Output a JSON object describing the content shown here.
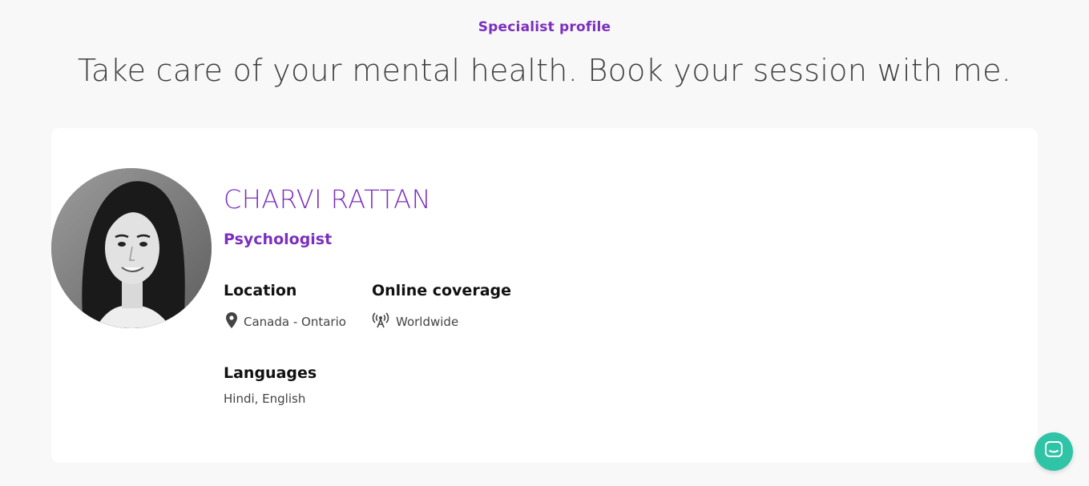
{
  "header": {
    "eyebrow": "Specialist profile",
    "headline": "Take care of your mental health. Book your session with me."
  },
  "profile": {
    "name": "CHARVI RATTAN",
    "role": "Psychologist",
    "location": {
      "label": "Location",
      "value": "Canada - Ontario",
      "icon": "map-pin-icon"
    },
    "online_coverage": {
      "label": "Online coverage",
      "value": "Worldwide",
      "icon": "broadcast-antenna-icon"
    },
    "languages": {
      "label": "Languages",
      "value": "Hindi, English"
    }
  },
  "chat": {
    "icon": "chat-bubble-icon"
  },
  "colors": {
    "accent": "#7b2fbf",
    "chat_button": "#2fc4a6",
    "background": "#f8f8f8",
    "card": "#ffffff"
  }
}
